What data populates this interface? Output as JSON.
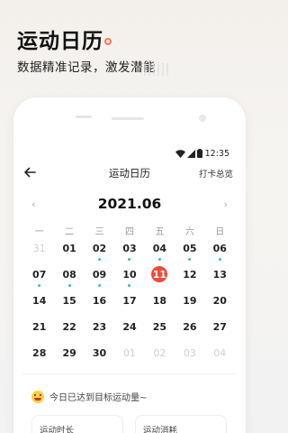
{
  "promo": {
    "title": "运动日历",
    "subtitle": "数据精准记录，激发潜能"
  },
  "status": {
    "time": "12:35",
    "icons": [
      "wifi-icon",
      "signal-icon",
      "battery-icon"
    ]
  },
  "nav": {
    "title": "运动日历",
    "right_action": "打卡总览"
  },
  "calendar": {
    "month": "2021.06",
    "prev_label": "‹",
    "next_label": "›",
    "weekdays": [
      "一",
      "二",
      "三",
      "四",
      "五",
      "六",
      "日"
    ],
    "days": [
      {
        "n": "31",
        "muted": true,
        "dot": false
      },
      {
        "n": "01",
        "muted": false,
        "dot": false
      },
      {
        "n": "02",
        "muted": false,
        "dot": true
      },
      {
        "n": "03",
        "muted": false,
        "dot": true
      },
      {
        "n": "04",
        "muted": false,
        "dot": true
      },
      {
        "n": "05",
        "muted": false,
        "dot": true
      },
      {
        "n": "06",
        "muted": false,
        "dot": true
      },
      {
        "n": "07",
        "muted": false,
        "dot": true
      },
      {
        "n": "08",
        "muted": false,
        "dot": true
      },
      {
        "n": "09",
        "muted": false,
        "dot": true
      },
      {
        "n": "10",
        "muted": false,
        "dot": true
      },
      {
        "n": "11",
        "muted": false,
        "dot": false,
        "today": true
      },
      {
        "n": "12",
        "muted": false,
        "dot": false
      },
      {
        "n": "13",
        "muted": false,
        "dot": false
      },
      {
        "n": "14",
        "muted": false,
        "dot": false
      },
      {
        "n": "15",
        "muted": false,
        "dot": false
      },
      {
        "n": "16",
        "muted": false,
        "dot": false
      },
      {
        "n": "17",
        "muted": false,
        "dot": false
      },
      {
        "n": "18",
        "muted": false,
        "dot": false
      },
      {
        "n": "19",
        "muted": false,
        "dot": false
      },
      {
        "n": "20",
        "muted": false,
        "dot": false
      },
      {
        "n": "21",
        "muted": false,
        "dot": false
      },
      {
        "n": "22",
        "muted": false,
        "dot": false
      },
      {
        "n": "23",
        "muted": false,
        "dot": false
      },
      {
        "n": "24",
        "muted": false,
        "dot": false
      },
      {
        "n": "25",
        "muted": false,
        "dot": false
      },
      {
        "n": "26",
        "muted": false,
        "dot": false
      },
      {
        "n": "27",
        "muted": false,
        "dot": false
      },
      {
        "n": "28",
        "muted": false,
        "dot": false
      },
      {
        "n": "29",
        "muted": false,
        "dot": false
      },
      {
        "n": "30",
        "muted": false,
        "dot": false
      },
      {
        "n": "01",
        "muted": true,
        "dot": false
      },
      {
        "n": "02",
        "muted": true,
        "dot": false
      },
      {
        "n": "03",
        "muted": true,
        "dot": false
      },
      {
        "n": "04",
        "muted": true,
        "dot": false
      }
    ]
  },
  "tip": {
    "text": "今日已达到目标运动量~"
  },
  "cards": [
    {
      "label": "运动时长"
    },
    {
      "label": "运动消耗"
    }
  ],
  "colors": {
    "accent": "#ef4b3c",
    "dot": "#3cc29a",
    "promo_dot": "#f07c5a"
  }
}
